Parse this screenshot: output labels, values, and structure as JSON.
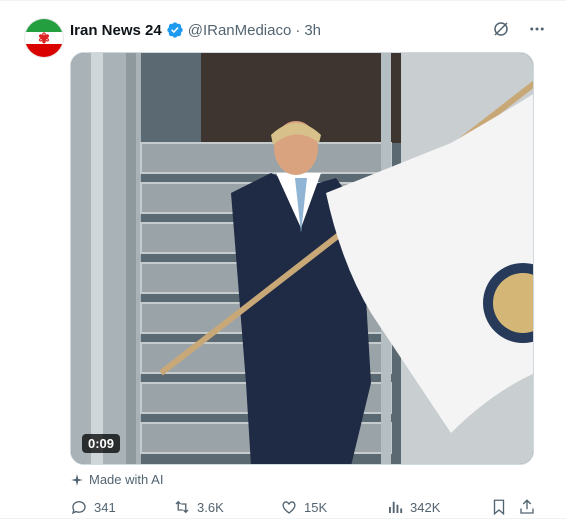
{
  "post": {
    "author_name": "Iran News 24",
    "handle": "@IRanMediaco",
    "separator": "·",
    "time": "3h",
    "media": {
      "duration": "0:09",
      "description_icon": "video-thumbnail"
    },
    "ai_label": "Made with AI",
    "stats": {
      "replies": "341",
      "reposts": "3.6K",
      "likes": "15K",
      "views": "342K"
    },
    "colors": {
      "verified": "#1d9bf0",
      "secondary_text": "#536471"
    }
  }
}
